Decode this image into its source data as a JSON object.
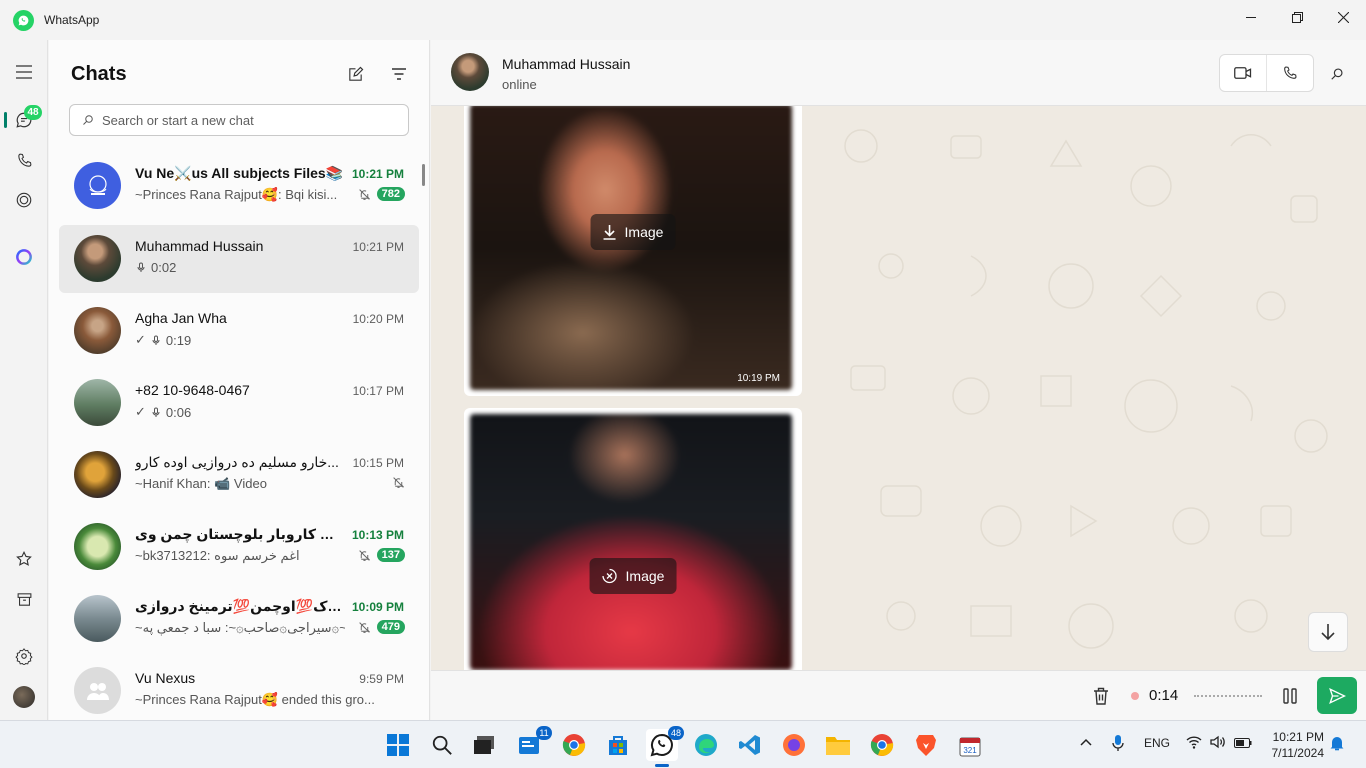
{
  "window": {
    "app_title": "WhatsApp",
    "controls": {
      "minimize": "—",
      "maximize": "▢",
      "close": "✕"
    }
  },
  "rail": {
    "chats_badge": "48"
  },
  "chats_panel": {
    "title": "Chats",
    "search_placeholder": "Search or start a new chat",
    "items": [
      {
        "name": "Vu Ne⚔️us All subjects Files📚",
        "time": "10:21 PM",
        "time_unread": true,
        "preview": "~Princes Rana Rajput🥰: Bqi kisi...",
        "muted": true,
        "unread": "782"
      },
      {
        "name": "Muhammad Hussain",
        "time": "10:21 PM",
        "time_unread": false,
        "preview": "0:02",
        "preview_icon": "mic-icon",
        "active": true
      },
      {
        "name": "Agha Jan Wha",
        "time": "10:20 PM",
        "time_unread": false,
        "preview": "0:19",
        "preview_icon": "mic-icon",
        "tick": "✓"
      },
      {
        "name": "+82 10-9648-0467",
        "time": "10:17 PM",
        "time_unread": false,
        "preview": "0:06",
        "preview_icon": "mic-icon",
        "tick": "✓"
      },
      {
        "name": "خارو مسلیم ده دروازیی اوده کارو...",
        "time": "10:15 PM",
        "time_unread": false,
        "preview": "~Hanif Khan: 📹 Video",
        "muted": true
      },
      {
        "name": "عمومی کاروبار بلوچستان چمن وی...",
        "time": "10:13 PM",
        "time_unread": true,
        "preview": "~bk3713212: اغم خرسم سوه",
        "muted": true,
        "unread": "137"
      },
      {
        "name": "دبولدک💯اوچمن💯ترمینخ دروازی...",
        "time": "10:09 PM",
        "time_unread": true,
        "preview": "~سیراجی۞صاحب۞~: سبا د جمعې په۞~...",
        "muted": true,
        "unread": "479"
      },
      {
        "name": "Vu Nexus",
        "time": "9:59 PM",
        "time_unread": false,
        "preview": "~Princes Rana Rajput🥰 ended this gro..."
      }
    ]
  },
  "conversation": {
    "contact_name": "Muhammad Hussain",
    "status": "online",
    "messages": [
      {
        "type": "image",
        "label": "Image",
        "action": "download",
        "time": "10:19 PM"
      },
      {
        "type": "image",
        "label": "Image",
        "action": "cancel",
        "time": ""
      }
    ],
    "recorder": {
      "duration": "0:14"
    }
  },
  "taskbar": {
    "apps": [
      {
        "name": "start",
        "badge": ""
      },
      {
        "name": "search",
        "badge": ""
      },
      {
        "name": "task-view",
        "badge": ""
      },
      {
        "name": "widgets",
        "badge": "11"
      },
      {
        "name": "chrome-color",
        "badge": ""
      },
      {
        "name": "store",
        "badge": ""
      },
      {
        "name": "whatsapp",
        "badge": "48"
      },
      {
        "name": "edge",
        "badge": ""
      },
      {
        "name": "vscode",
        "badge": ""
      },
      {
        "name": "firefox",
        "badge": ""
      },
      {
        "name": "file-explorer",
        "badge": ""
      },
      {
        "name": "chrome",
        "badge": ""
      },
      {
        "name": "brave",
        "badge": ""
      },
      {
        "name": "calendar",
        "badge": ""
      }
    ],
    "tray": {
      "language": "ENG",
      "time": "10:21 PM",
      "date": "7/11/2024"
    }
  },
  "colors": {
    "accent": "#25d366",
    "badge_green": "#25a55f",
    "send": "#1daa61"
  }
}
